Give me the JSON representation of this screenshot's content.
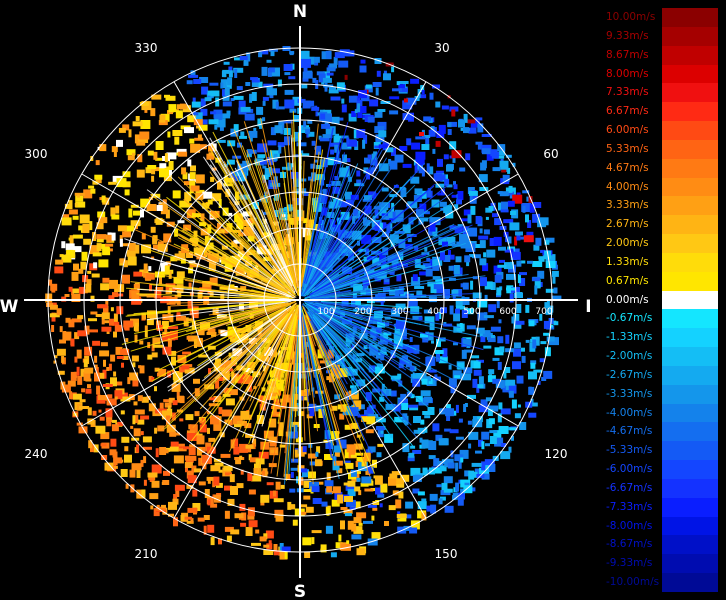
{
  "radar": {
    "cardinals": {
      "north": "N",
      "south": "S",
      "east": "E",
      "west": "W"
    },
    "bearings": [
      "30",
      "60",
      "120",
      "150",
      "210",
      "240",
      "300",
      "330"
    ],
    "range_labels": [
      "100",
      "200",
      "300",
      "400",
      "500",
      "600",
      "700"
    ]
  },
  "legend": {
    "items": [
      {
        "label": "10.00m/s",
        "color": "#8b0000",
        "text_color": "#8b0000"
      },
      {
        "label": "9.33m/s",
        "color": "#a50000",
        "text_color": "#a50000"
      },
      {
        "label": "8.67m/s",
        "color": "#c00000",
        "text_color": "#c00000"
      },
      {
        "label": "8.00m/s",
        "color": "#dc0000",
        "text_color": "#dc0000"
      },
      {
        "label": "7.33m/s",
        "color": "#f01010",
        "text_color": "#f01010"
      },
      {
        "label": "6.67m/s",
        "color": "#ff2a14",
        "text_color": "#ff2a14"
      },
      {
        "label": "6.00m/s",
        "color": "#ff4a14",
        "text_color": "#ff4a14"
      },
      {
        "label": "5.33m/s",
        "color": "#ff6414",
        "text_color": "#ff6414"
      },
      {
        "label": "4.67m/s",
        "color": "#ff7a14",
        "text_color": "#ff7a14"
      },
      {
        "label": "4.00m/s",
        "color": "#ff8c14",
        "text_color": "#ff8c14"
      },
      {
        "label": "3.33m/s",
        "color": "#ffa014",
        "text_color": "#ffa014"
      },
      {
        "label": "2.67m/s",
        "color": "#ffb414",
        "text_color": "#ffb414"
      },
      {
        "label": "2.00m/s",
        "color": "#ffc814",
        "text_color": "#ffc814"
      },
      {
        "label": "1.33m/s",
        "color": "#ffdc0a",
        "text_color": "#ffdc0a"
      },
      {
        "label": "0.67m/s",
        "color": "#ffe600",
        "text_color": "#ffe600"
      },
      {
        "label": "0.00m/s",
        "color": "#ffffff",
        "text_color": "#ffffff"
      },
      {
        "label": "-0.67m/s",
        "color": "#14e6ff",
        "text_color": "#14e6ff"
      },
      {
        "label": "-1.33m/s",
        "color": "#14d2ff",
        "text_color": "#14d2ff"
      },
      {
        "label": "-2.00m/s",
        "color": "#14bef5",
        "text_color": "#14bef5"
      },
      {
        "label": "-2.67m/s",
        "color": "#14aaf0",
        "text_color": "#14aaf0"
      },
      {
        "label": "-3.33m/s",
        "color": "#1496eb",
        "text_color": "#1496eb"
      },
      {
        "label": "-4.00m/s",
        "color": "#1482eb",
        "text_color": "#1482eb"
      },
      {
        "label": "-4.67m/s",
        "color": "#146ef0",
        "text_color": "#146ef0"
      },
      {
        "label": "-5.33m/s",
        "color": "#145af5",
        "text_color": "#145af5"
      },
      {
        "label": "-6.00m/s",
        "color": "#1446ff",
        "text_color": "#1446ff"
      },
      {
        "label": "-6.67m/s",
        "color": "#1432ff",
        "text_color": "#1432ff"
      },
      {
        "label": "-7.33m/s",
        "color": "#0a1eff",
        "text_color": "#0a1eff"
      },
      {
        "label": "-8.00m/s",
        "color": "#0014e6",
        "text_color": "#0014e6"
      },
      {
        "label": "-8.67m/s",
        "color": "#0010c8",
        "text_color": "#0010c8"
      },
      {
        "label": "-9.33m/s",
        "color": "#000cb0",
        "text_color": "#000cb0"
      },
      {
        "label": "-10.00m/s",
        "color": "#000a96",
        "text_color": "#000a96"
      }
    ]
  }
}
